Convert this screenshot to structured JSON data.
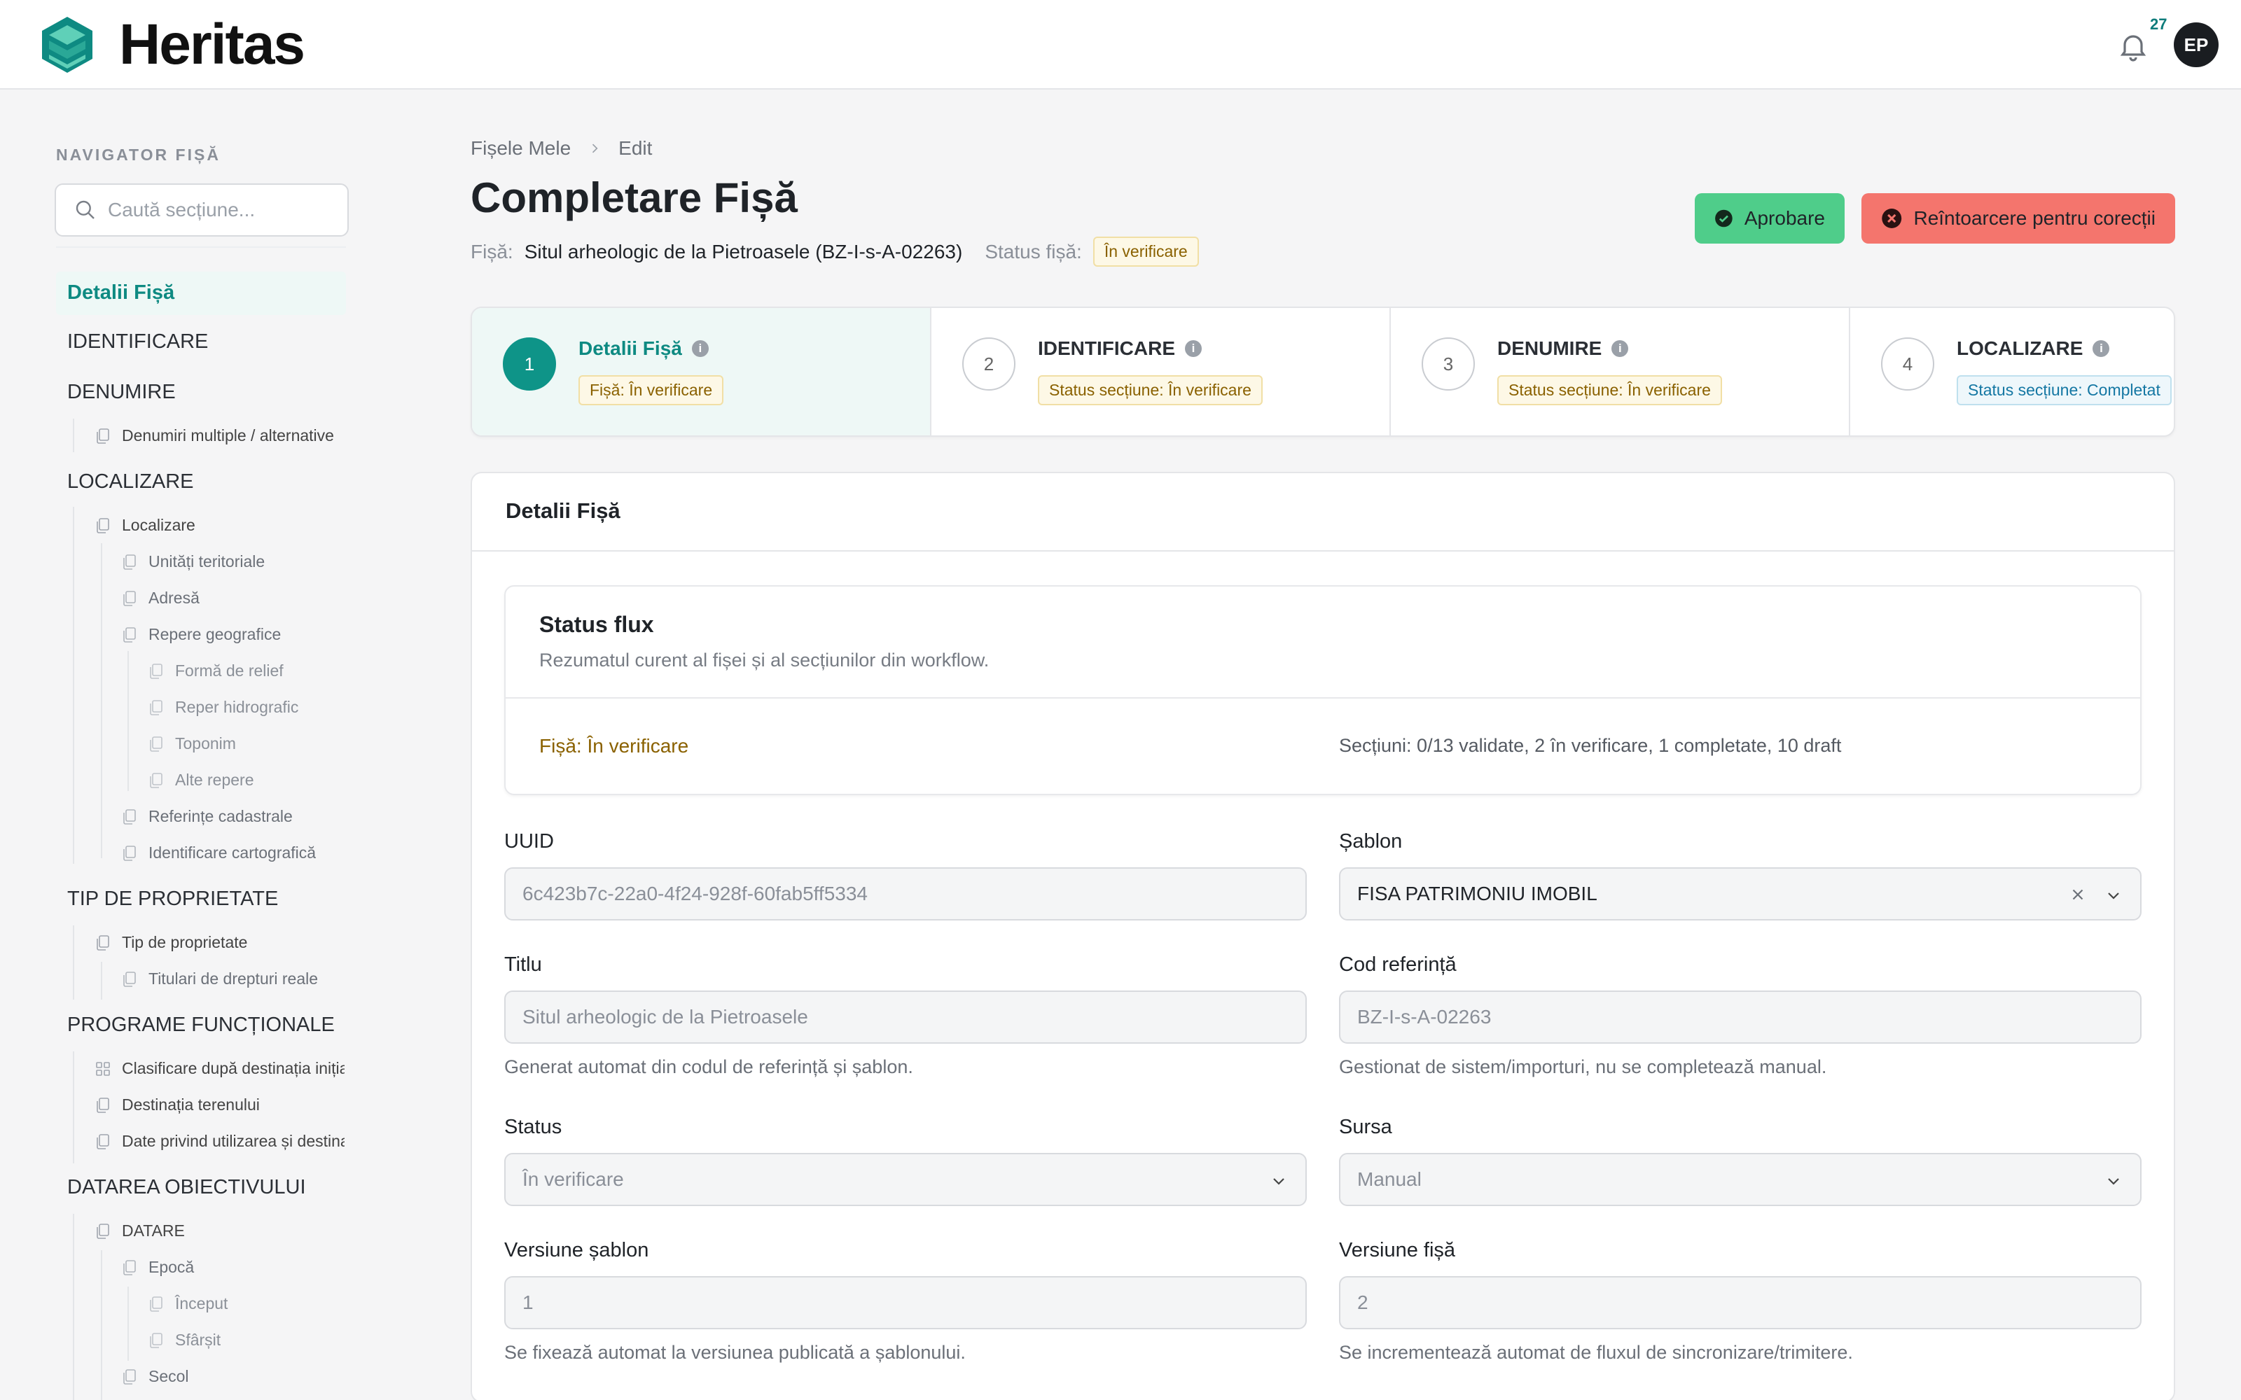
{
  "app": {
    "brand": "Heritas",
    "notifications": "27",
    "user_initials": "EP"
  },
  "sidebar": {
    "title": "NAVIGATOR FIȘĂ",
    "search_placeholder": "Caută secțiune...",
    "items": [
      {
        "label": "Detalii Fișă"
      },
      {
        "label": "IDENTIFICARE"
      },
      {
        "label": "DENUMIRE"
      },
      {
        "label": "Denumiri multiple / alternative"
      },
      {
        "label": "LOCALIZARE"
      },
      {
        "label": "Localizare"
      },
      {
        "label": "Unități teritoriale"
      },
      {
        "label": "Adresă"
      },
      {
        "label": "Repere geografice"
      },
      {
        "label": "Formă de relief"
      },
      {
        "label": "Reper hidrografic"
      },
      {
        "label": "Toponim"
      },
      {
        "label": "Alte repere"
      },
      {
        "label": "Referințe cadastrale"
      },
      {
        "label": "Identificare cartografică"
      },
      {
        "label": "TIP DE PROPRIETATE"
      },
      {
        "label": "Tip de proprietate"
      },
      {
        "label": "Titulari de drepturi reale"
      },
      {
        "label": "PROGRAME FUNCȚIONALE"
      },
      {
        "label": "Clasificare după destinația inițială"
      },
      {
        "label": "Destinația terenului"
      },
      {
        "label": "Date privind utilizarea și destinația"
      },
      {
        "label": "DATAREA OBIECTIVULUI"
      },
      {
        "label": "DATARE"
      },
      {
        "label": "Epocă"
      },
      {
        "label": "Început"
      },
      {
        "label": "Sfârșit"
      },
      {
        "label": "Secol"
      }
    ]
  },
  "breadcrumb": {
    "home": "Fișele Mele",
    "current": "Edit"
  },
  "page": {
    "title": "Completare Fișă",
    "fisa_label": "Fișă:",
    "fisa_value": "Situl arheologic de la Pietroasele (BZ-I-s-A-02263)",
    "status_label": "Status fișă:",
    "status_value": "În verificare"
  },
  "actions": {
    "approve": "Aprobare",
    "return": "Reîntoarcere pentru corecții"
  },
  "steps": [
    {
      "num": "1",
      "title": "Detalii Fișă",
      "status": "Fișă: În verificare"
    },
    {
      "num": "2",
      "title": "IDENTIFICARE",
      "status": "Status secțiune: În verificare"
    },
    {
      "num": "3",
      "title": "DENUMIRE",
      "status": "Status secțiune: În verificare"
    },
    {
      "num": "4",
      "title": "LOCALIZARE",
      "status": "Status secțiune: Completat"
    }
  ],
  "card": {
    "title": "Detalii Fișă"
  },
  "flux": {
    "title": "Status flux",
    "desc": "Rezumatul curent al fișei și al secțiunilor din workflow.",
    "fisa_status": "Fișă: În verificare",
    "sections_status": "Secțiuni: 0/13 validate, 2 în verificare, 1 completate, 10 draft"
  },
  "fields": {
    "uuid": {
      "label": "UUID",
      "value": "6c423b7c-22a0-4f24-928f-60fab5ff5334"
    },
    "sablon": {
      "label": "Șablon",
      "value": "FISA PATRIMONIU IMOBIL"
    },
    "titlu": {
      "label": "Titlu",
      "value": "Situl arheologic de la Pietroasele",
      "hint": "Generat automat din codul de referință și șablon."
    },
    "cod": {
      "label": "Cod referință",
      "value": "BZ-I-s-A-02263",
      "hint": "Gestionat de sistem/importuri, nu se completează manual."
    },
    "status": {
      "label": "Status",
      "value": "În verificare"
    },
    "sursa": {
      "label": "Sursa",
      "value": "Manual"
    },
    "versiune_sablon": {
      "label": "Versiune șablon",
      "value": "1",
      "hint": "Se fixează automat la versiunea publicată a șablonului."
    },
    "versiune_fisa": {
      "label": "Versiune fișă",
      "value": "2",
      "hint": "Se incrementează automat de fluxul de sincronizare/trimitere."
    }
  },
  "colors": {
    "accent": "#0e9488",
    "approve": "#4fcd8a",
    "return": "#f4756d",
    "warn_text": "#8a6100"
  }
}
